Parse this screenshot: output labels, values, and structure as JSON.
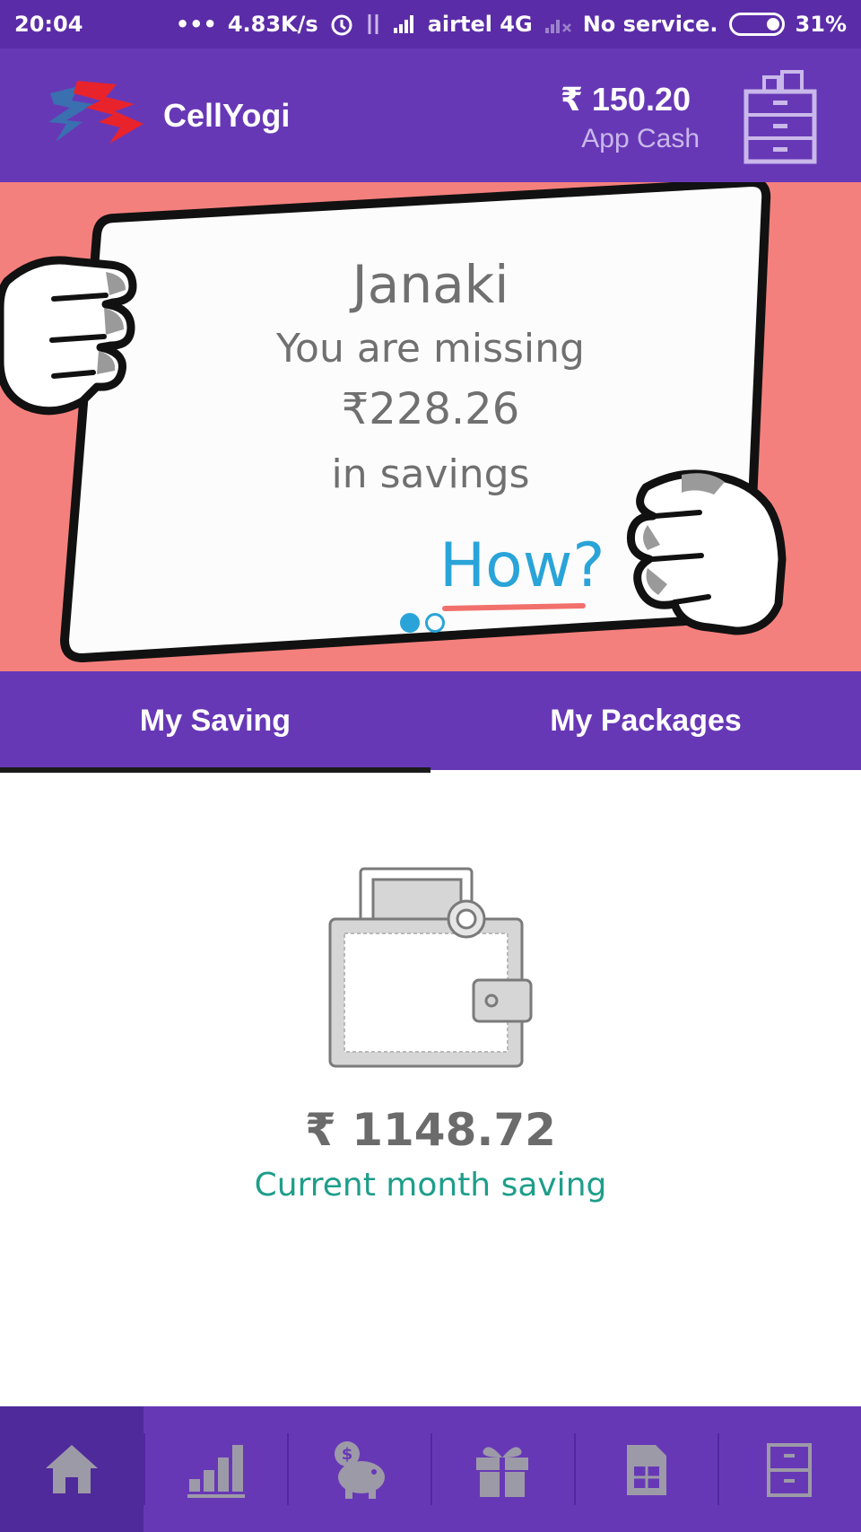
{
  "status_bar": {
    "time": "20:04",
    "dots": "•••",
    "speed": "4.83K/s",
    "carrier": "airtel 4G",
    "sim2_status": "No service.",
    "battery": "31%"
  },
  "app_bar": {
    "title": "CellYogi",
    "cash_amount": "₹ 150.20",
    "cash_label": "App Cash"
  },
  "banner": {
    "name": "Janaki",
    "line1": "You are missing",
    "amount": "₹228.26",
    "line2": "in savings",
    "cta": "How?"
  },
  "tabs": [
    {
      "label": "My Saving",
      "active": true
    },
    {
      "label": "My Packages",
      "active": false
    }
  ],
  "saving": {
    "amount": "₹ 1148.72",
    "label": "Current month saving"
  },
  "bottom_nav": [
    {
      "icon": "home-icon",
      "active": true
    },
    {
      "icon": "bar-chart-icon",
      "active": false
    },
    {
      "icon": "piggy-bank-icon",
      "active": false
    },
    {
      "icon": "gift-icon",
      "active": false
    },
    {
      "icon": "sim-card-icon",
      "active": false
    },
    {
      "icon": "cabinet-icon",
      "active": false
    }
  ],
  "colors": {
    "primary": "#6738b6",
    "status_bar": "#5b2ca8",
    "banner_bg": "#f4807d",
    "accent_blue": "#2aa4d8",
    "saving_green": "#1e9e8a"
  }
}
